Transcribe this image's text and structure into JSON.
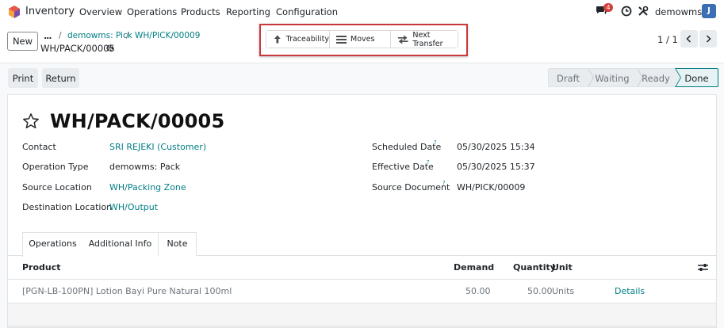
{
  "topbar": {
    "app_name": "Inventory",
    "menus": [
      "Overview",
      "Operations",
      "Products",
      "Reporting",
      "Configuration"
    ],
    "chat_badge": "4",
    "username": "demowms",
    "avatar_letter": "J"
  },
  "control": {
    "new_label": "New",
    "dots": "...",
    "breadcrumb": [
      "demowms: Pick",
      "WH/PICK/00009"
    ],
    "record_name": "WH/PACK/00005",
    "smart_buttons": [
      "Traceability",
      "Moves",
      "Next Transfer"
    ],
    "pager": "1 / 1"
  },
  "actions": {
    "print": "Print",
    "return": "Return",
    "statuses": [
      "Draft",
      "Waiting",
      "Ready",
      "Done"
    ],
    "active_status": "Done"
  },
  "form": {
    "title": "WH/PACK/00005",
    "left_fields": [
      {
        "label": "Contact",
        "value": "SRI REJEKI (Customer)",
        "link": true
      },
      {
        "label": "Operation Type",
        "value": "demowms: Pack",
        "link": false
      },
      {
        "label": "Source Location",
        "value": "WH/Packing Zone",
        "link": true
      },
      {
        "label": "Destination Location",
        "value": "WH/Output",
        "link": true
      }
    ],
    "right_fields": [
      {
        "label": "Scheduled Date",
        "value": "05/30/2025 15:34",
        "help": "?"
      },
      {
        "label": "Effective Date",
        "value": "05/30/2025 15:37",
        "help": "?"
      },
      {
        "label": "Source Document",
        "value": "WH/PICK/00009",
        "help": "?"
      }
    ]
  },
  "tabs": [
    "Operations",
    "Additional Info",
    "Note"
  ],
  "table": {
    "headers": {
      "product": "Product",
      "demand": "Demand",
      "quantity": "Quantity",
      "unit": "Unit"
    },
    "rows": [
      {
        "product": "[PGN-LB-100PN] Lotion Bayi Pure Natural 100ml",
        "demand": "50.00",
        "quantity": "50.00",
        "unit": "Units",
        "details": "Details"
      }
    ]
  },
  "colors": {
    "accent": "#017e84",
    "highlight": "#c8393c",
    "badge": "#d23f3a"
  }
}
